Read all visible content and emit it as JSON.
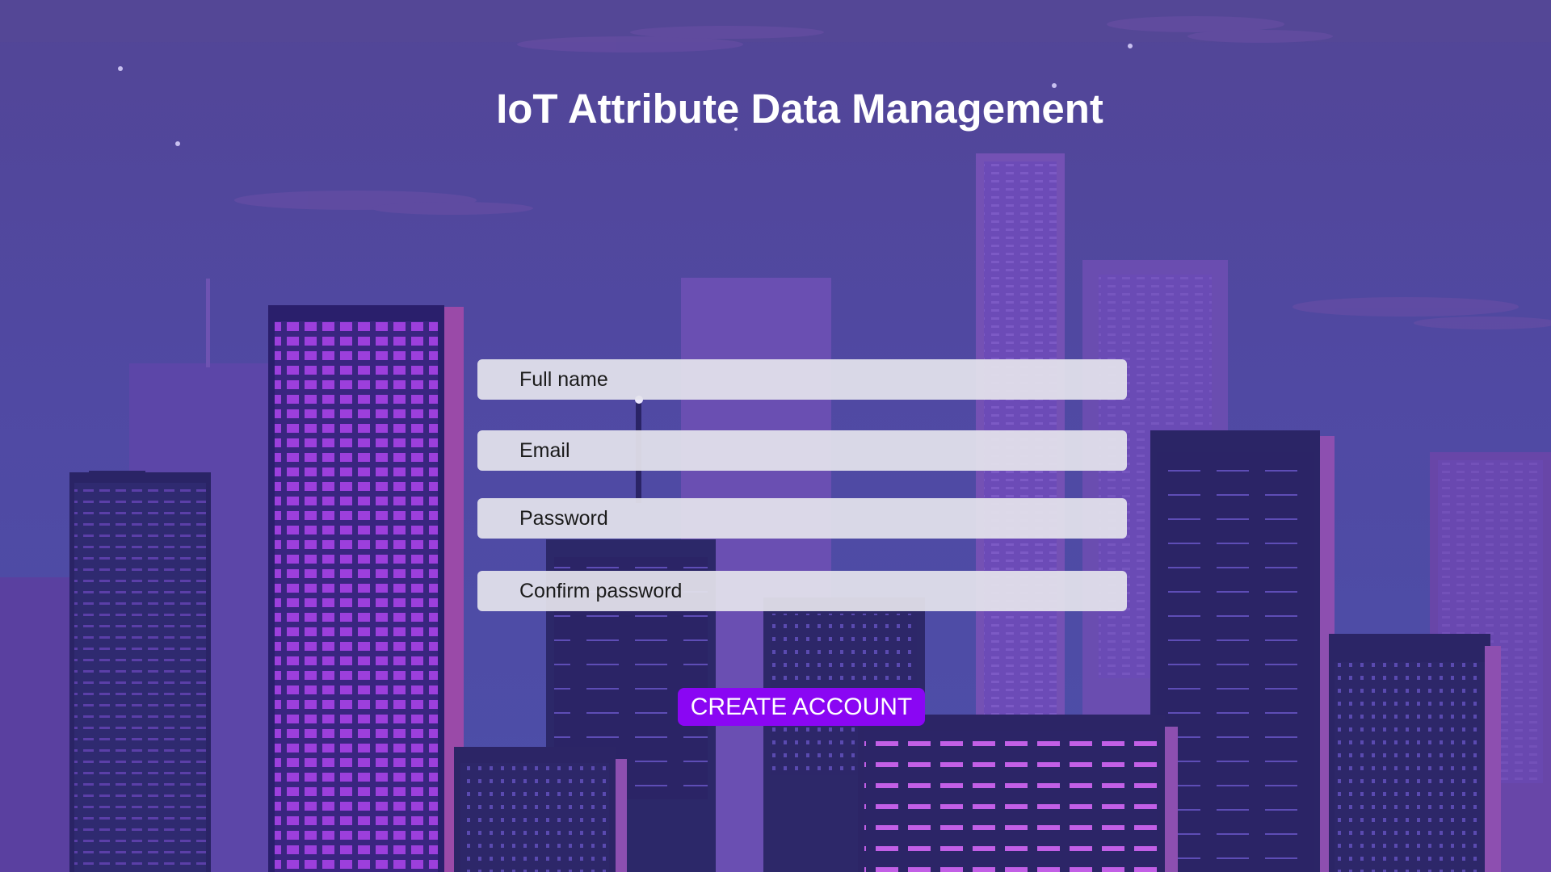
{
  "page": {
    "title": "IoT Attribute Data Management"
  },
  "form": {
    "full_name": {
      "placeholder": "Full name",
      "value": ""
    },
    "email": {
      "placeholder": "Email",
      "value": ""
    },
    "password": {
      "placeholder": "Password",
      "value": ""
    },
    "confirm_password": {
      "placeholder": "Confirm password",
      "value": ""
    }
  },
  "actions": {
    "create_account_label": "CREATE ACCOUNT"
  },
  "colors": {
    "sky": "#5049a0",
    "accent": "#8a06f3",
    "field_background": "#e4e3ec",
    "title_text": "#ffffff"
  }
}
